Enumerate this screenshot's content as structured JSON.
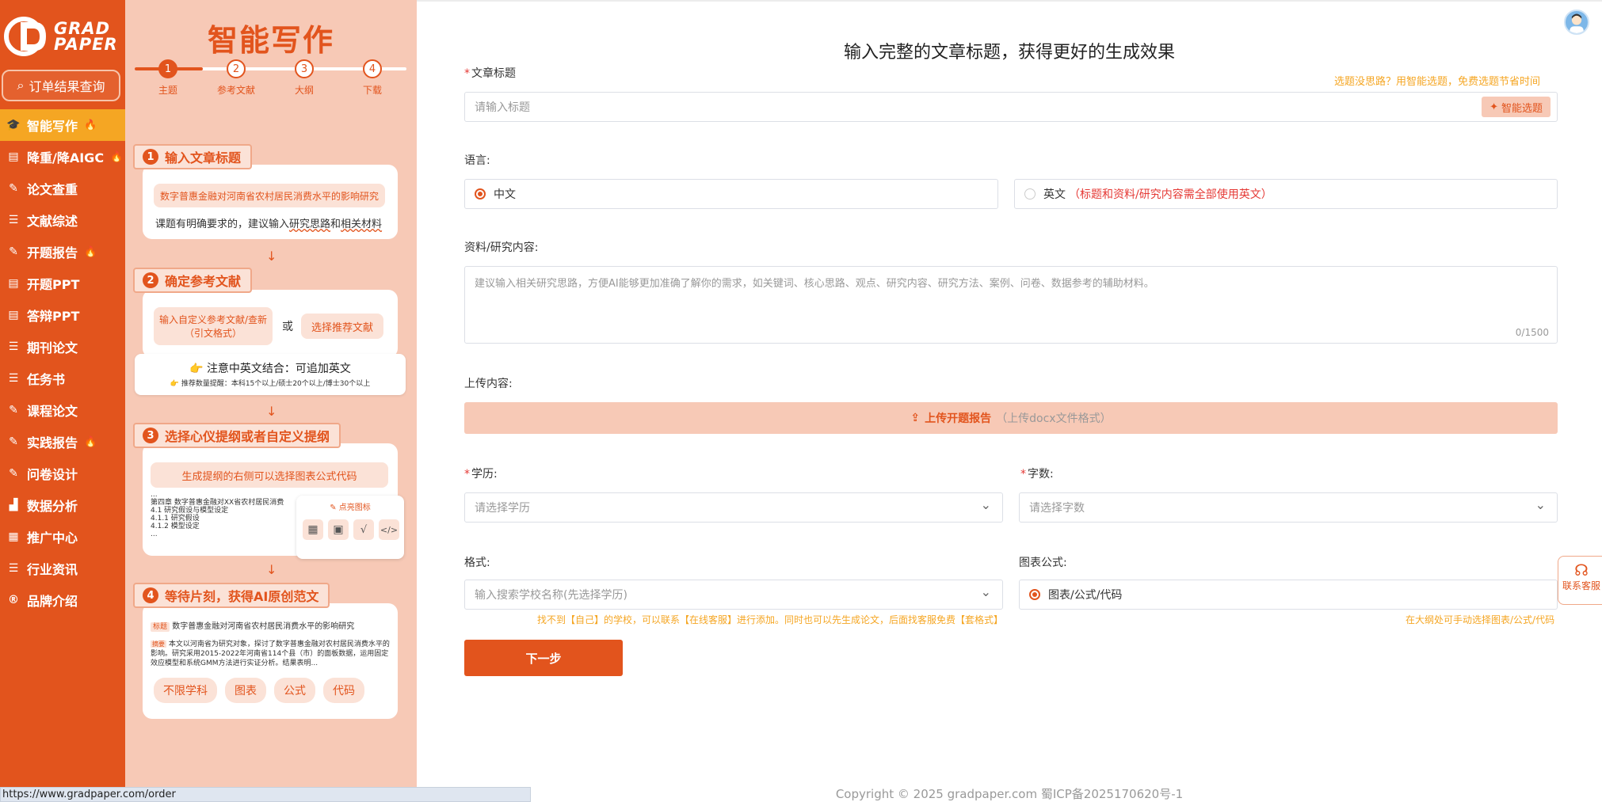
{
  "brand": {
    "logo_line1": "GRAD",
    "logo_line2": "PAPER",
    "order_query": "订单结果查询"
  },
  "sidebar": {
    "items": [
      {
        "label": "智能写作",
        "icon": "graduation-cap-icon",
        "glyph": "🎓",
        "fire": true,
        "active": true
      },
      {
        "label": "降重/降AIGC",
        "icon": "clipboard-icon",
        "glyph": "▤",
        "fire": true
      },
      {
        "label": "论文查重",
        "icon": "edit-doc-icon",
        "glyph": "✎",
        "fire": false
      },
      {
        "label": "文献综述",
        "icon": "list-doc-icon",
        "glyph": "☰",
        "fire": false
      },
      {
        "label": "开题报告",
        "icon": "report-icon",
        "glyph": "✎",
        "fire": true
      },
      {
        "label": "开题PPT",
        "icon": "ppt-icon",
        "glyph": "▤",
        "fire": false
      },
      {
        "label": "答辩PPT",
        "icon": "ppt-icon",
        "glyph": "▤",
        "fire": false
      },
      {
        "label": "期刊论文",
        "icon": "journal-icon",
        "glyph": "☰",
        "fire": false
      },
      {
        "label": "任务书",
        "icon": "task-book-icon",
        "glyph": "☰",
        "fire": false
      },
      {
        "label": "课程论文",
        "icon": "course-paper-icon",
        "glyph": "✎",
        "fire": false
      },
      {
        "label": "实践报告",
        "icon": "practice-report-icon",
        "glyph": "✎",
        "fire": true
      },
      {
        "label": "问卷设计",
        "icon": "survey-icon",
        "glyph": "✎",
        "fire": false
      },
      {
        "label": "数据分析",
        "icon": "chart-icon",
        "glyph": "▟",
        "fire": false
      },
      {
        "label": "推广中心",
        "icon": "grid-icon",
        "glyph": "▦",
        "fire": false
      },
      {
        "label": "行业资讯",
        "icon": "news-icon",
        "glyph": "☰",
        "fire": false
      },
      {
        "label": "品牌介绍",
        "icon": "registered-icon",
        "glyph": "®",
        "fire": false
      }
    ]
  },
  "guide": {
    "title": "智能写作",
    "steps": [
      {
        "n": "1",
        "label": "主题"
      },
      {
        "n": "2",
        "label": "参考文献"
      },
      {
        "n": "3",
        "label": "大纲"
      },
      {
        "n": "4",
        "label": "下载"
      }
    ],
    "s1": {
      "n": "1",
      "title": "输入文章标题",
      "example": "数字普惠金融对河南省农村居民消费水平的影响研究",
      "hint_pre": "课题有明确要求的，建议输入",
      "hint_a": "研究思路",
      "hint_and": "和",
      "hint_b": "相关材料"
    },
    "s2": {
      "n": "2",
      "title": "确定参考文献",
      "opt1": "输入自定义参考文献/查新（引文格式）",
      "or": "或",
      "opt2": "选择推荐文献",
      "note1": "注意中英文结合：可追加英文",
      "note2": "推荐数量提醒：本科15个以上/硕士20个以上/博士30个以上"
    },
    "s3": {
      "n": "3",
      "title": "选择心仪提纲或者自定义提纲",
      "tip": "生成提纲的右侧可以选择图表公式代码",
      "outline": [
        "...",
        "第四章 数字普惠金融对XX省农村居民消费",
        "4.1 研究假设与模型设定",
        "4.1.1 研究假设",
        "4.1.2 模型设定",
        "..."
      ],
      "popup": "点亮图标"
    },
    "s4": {
      "n": "4",
      "title": "等待片刻，获得AI原创范文",
      "tag_title": "标题",
      "title_text": "数字普惠金融对河南省农村居民消费水平的影响研究",
      "tag_abs": "摘要",
      "abs_text": "本文以河南省为研究对象，探讨了数字普惠金融对农村居民消费水平的影响。研究采用2015-2022年河南省114个县（市）的面板数据，运用固定效应模型和系统GMM方法进行实证分析。结果表明...",
      "chips": [
        "不限学科",
        "图表",
        "公式",
        "代码"
      ]
    }
  },
  "form": {
    "heading": "输入完整的文章标题，获得更好的生成效果",
    "title_label": "文章标题",
    "title_tip": "选题没思路？用智能选题，免费选题节省时间",
    "title_placeholder": "请输入标题",
    "smart_topic": "智能选题",
    "lang_label": "语言:",
    "lang_cn": "中文",
    "lang_en": "英文",
    "lang_en_note": "（标题和资料/研究内容需全部使用英文）",
    "material_label": "资料/研究内容:",
    "material_placeholder": "建议输入相关研究思路，方便AI能够更加准确了解你的需求，如关键词、核心思路、观点、研究内容、研究方法、案例、问卷、数据参考的辅助材料。",
    "material_count": "0/1500",
    "upload_label": "上传内容:",
    "upload_btn": "上传开题报告",
    "upload_hint": "（上传docx文件格式）",
    "edu_label": "学历:",
    "edu_placeholder": "请选择学历",
    "words_label": "字数:",
    "words_placeholder": "请选择字数",
    "format_label": "格式:",
    "format_placeholder": "输入搜索学校名称(先选择学历)",
    "format_note": "找不到【自己】的学校，可以联系【在线客服】进行添加。同时也可以先生成论文，后面找客服免费【套格式】",
    "chart_label": "图表公式:",
    "chart_option": "图表/公式/代码",
    "chart_note": "在大纲处可手动选择图表/公式/代码",
    "next": "下一步"
  },
  "footer": "Copyright © 2025 gradpaper.com 蜀ICP备2025170620号-1",
  "status_url": "https://www.gradpaper.com/order",
  "contact": "联系客服",
  "colors": {
    "brand": "#e2541d",
    "guide_bg": "#f7c9b6",
    "active": "#f5a623",
    "tip": "#f5a623"
  }
}
